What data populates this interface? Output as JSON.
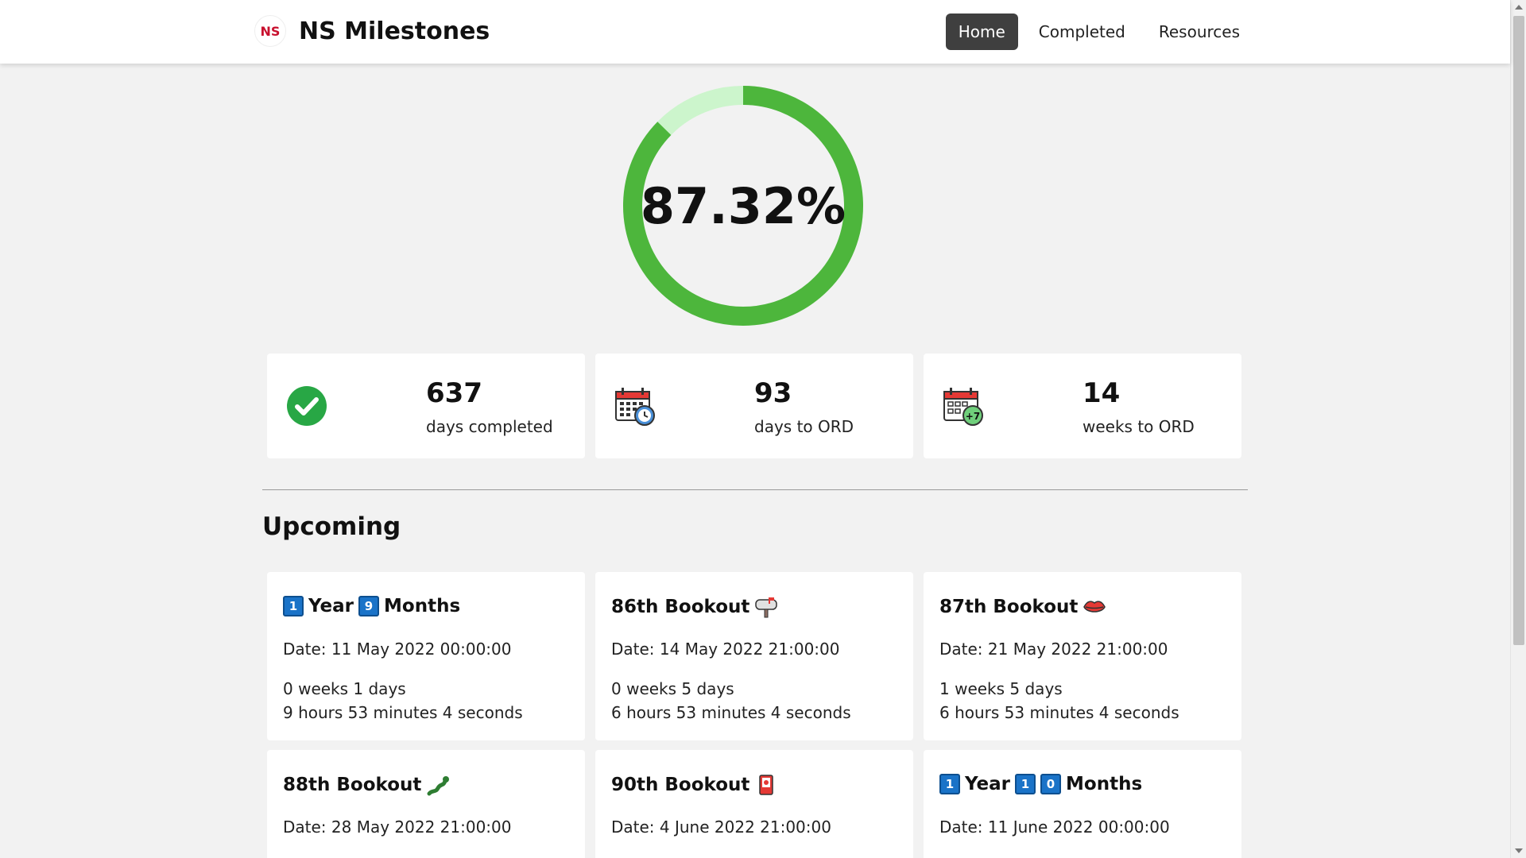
{
  "header": {
    "logo_text": "NS",
    "title": "NS Milestones",
    "nav": [
      {
        "label": "Home",
        "active": true
      },
      {
        "label": "Completed",
        "active": false
      },
      {
        "label": "Resources",
        "active": false
      }
    ]
  },
  "progress": {
    "percent_label": "87.32%",
    "fraction": 0.8732,
    "complete_color": "#4db63c",
    "remaining_color": "#ccf5cc"
  },
  "stats": [
    {
      "value": "637",
      "label": "days completed",
      "icon": "check-circle-icon"
    },
    {
      "value": "93",
      "label": "days to ORD",
      "icon": "calendar-clock-icon"
    },
    {
      "value": "14",
      "label": "weeks to ORD",
      "icon": "calendar-plus7-icon"
    }
  ],
  "upcoming": {
    "heading": "Upcoming",
    "items": [
      {
        "title_parts": [
          "1",
          "Year",
          "9",
          "Months"
        ],
        "emoji": "",
        "date": "Date: 11 May 2022 00:00:00",
        "remaining_1": "0 weeks 1 days",
        "remaining_2": "9 hours 53 minutes 4 seconds"
      },
      {
        "title": "86th Bookout",
        "emoji": "mailbox-icon",
        "date": "Date: 14 May 2022 21:00:00",
        "remaining_1": "0 weeks 5 days",
        "remaining_2": "6 hours 53 minutes 4 seconds"
      },
      {
        "title": "87th Bookout",
        "emoji": "lips-icon",
        "date": "Date: 21 May 2022 21:00:00",
        "remaining_1": "1 weeks 5 days",
        "remaining_2": "6 hours 53 minutes 4 seconds"
      },
      {
        "title": "88th Bookout",
        "emoji": "snake-icon",
        "date": "Date: 28 May 2022 21:00:00"
      },
      {
        "title": "90th Bookout",
        "emoji": "card-icon",
        "date": "Date: 4 June 2022 21:00:00"
      },
      {
        "title_parts": [
          "1",
          "Year",
          "1",
          "0",
          "Months"
        ],
        "emoji": "",
        "date": "Date: 11 June 2022 00:00:00"
      }
    ]
  }
}
